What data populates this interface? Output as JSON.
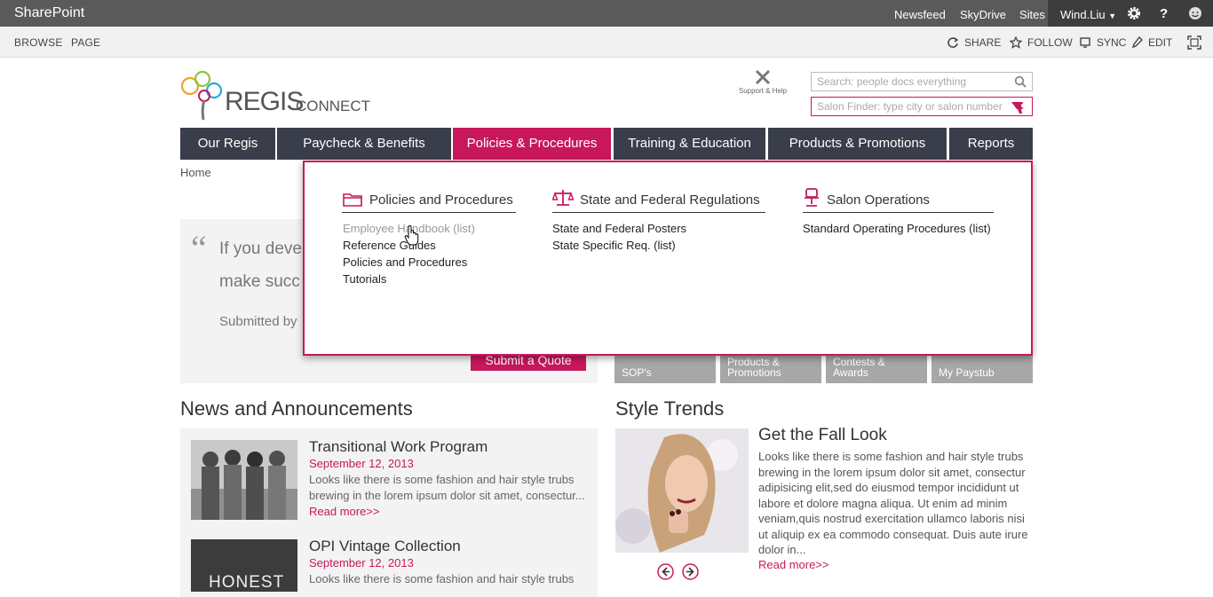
{
  "suite_bar": {
    "brand": "SharePoint",
    "links": [
      "Newsfeed",
      "SkyDrive",
      "Sites"
    ],
    "user": "Wind.Liu"
  },
  "ribbon": {
    "tabs": [
      "BROWSE",
      "PAGE"
    ],
    "actions": [
      "SHARE",
      "FOLLOW",
      "SYNC",
      "EDIT"
    ]
  },
  "logo": {
    "main": "REGIS",
    "sub": "CONNECT"
  },
  "support": {
    "label": "Support & Help"
  },
  "search": {
    "placeholder": "Search: people docs everything",
    "salon_placeholder": "Salon Finder: type city or salon number"
  },
  "nav": {
    "items": [
      "Our Regis",
      "Paycheck & Benefits",
      "Policies & Procedures",
      "Training & Education",
      "Products & Promotions",
      "Reports"
    ]
  },
  "breadcrumb": "Home",
  "mega_menu": {
    "columns": [
      {
        "heading": "Policies and Procedures",
        "links": [
          "Employee Handbook (list)",
          "Reference Guides",
          "Policies and Procedures",
          "Tutorials"
        ]
      },
      {
        "heading": "State and Federal Regulations",
        "links": [
          "State and Federal Posters",
          "State Specific Req. (list)"
        ]
      },
      {
        "heading": "Salon Operations",
        "links": [
          "Standard Operating Procedures (list)"
        ]
      }
    ]
  },
  "quote": {
    "line1": "If you deve",
    "line2": "make succ",
    "submitted": "Submitted by",
    "button": "Submit a Quote"
  },
  "tiles": [
    "SOP's",
    "Products & Promotions",
    "Contests & Awards",
    "My Paystub"
  ],
  "news": {
    "title": "News and Announcements",
    "items": [
      {
        "title": "Transitional Work Program",
        "date": "September 12, 2013",
        "body": "Looks like there is some fashion and hair style trubs brewing in the lorem ipsum dolor sit amet, consectur...",
        "more": "Read more>>"
      },
      {
        "title": "OPI Vintage Collection",
        "date": "September 12, 2013",
        "body": "Looks like there is some fashion and hair style trubs",
        "image_text": "HONEST"
      }
    ]
  },
  "style_trends": {
    "title": "Style Trends",
    "headline": "Get the Fall Look",
    "body": "Looks like there is some fashion and hair style trubs brewing in the lorem ipsum dolor sit amet, consectur adipisicing elit,sed do eiusmod tempor incididunt ut labore et dolore magna aliqua. Ut enim ad minim veniam,quis nostrud exercitation ullamco laboris nisi ut aliquip ex ea commodo consequat. Duis aute irure dolor in...",
    "more": "Read more>>"
  },
  "colors": {
    "accent": "#c8175d",
    "nav": "#3a3e4a",
    "suite": "#5a5a5a"
  }
}
